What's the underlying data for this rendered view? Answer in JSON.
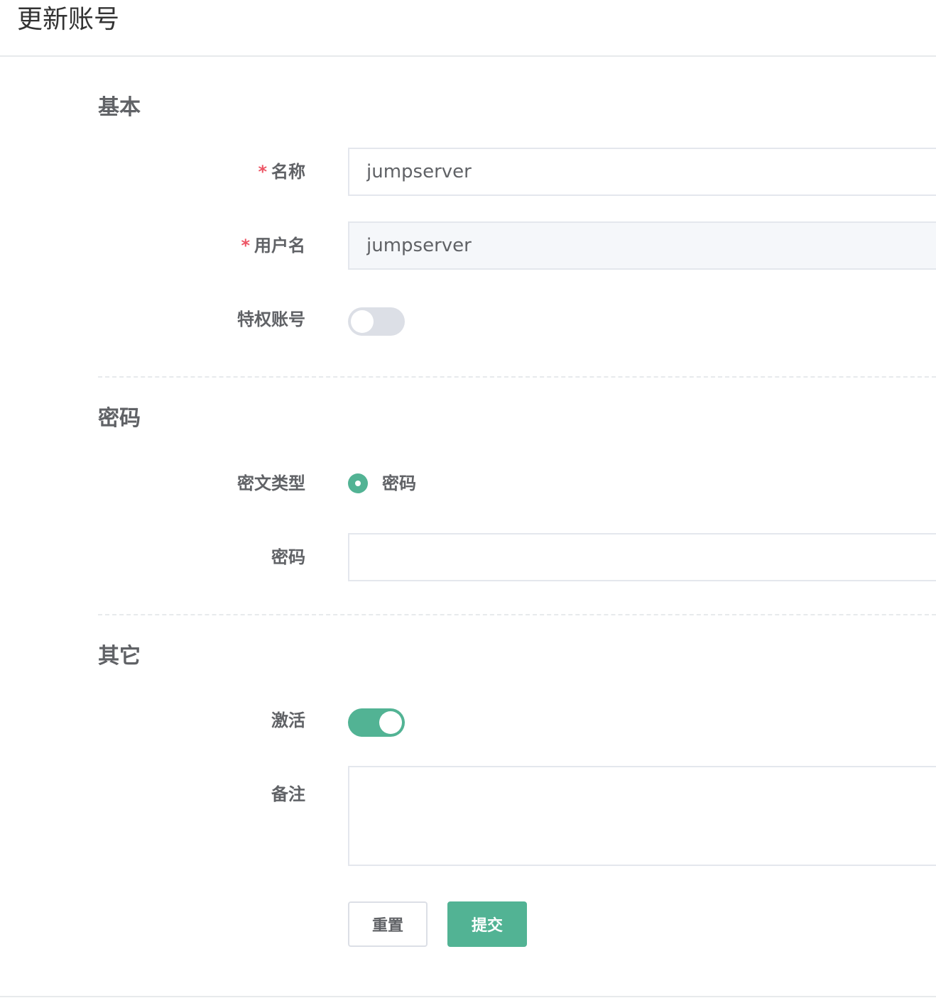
{
  "page": {
    "title": "更新账号"
  },
  "sections": {
    "basic": {
      "title": "基本",
      "name": {
        "required_mark": "*",
        "label": "名称",
        "value": "jumpserver"
      },
      "username": {
        "required_mark": "*",
        "label": "用户名",
        "value": "jumpserver"
      },
      "privileged": {
        "label": "特权账号",
        "checked": false
      }
    },
    "password": {
      "title": "密码",
      "secret_type": {
        "label": "密文类型",
        "option": "密码",
        "selected": true
      },
      "secret": {
        "label": "密码",
        "value": ""
      }
    },
    "other": {
      "title": "其它",
      "active": {
        "label": "激活",
        "checked": true
      },
      "comment": {
        "label": "备注",
        "value": ""
      }
    }
  },
  "actions": {
    "reset_label": "重置",
    "submit_label": "提交"
  },
  "colors": {
    "primary": "#52b394",
    "required": "#ed5565",
    "switch_off": "#dcdfe6"
  }
}
